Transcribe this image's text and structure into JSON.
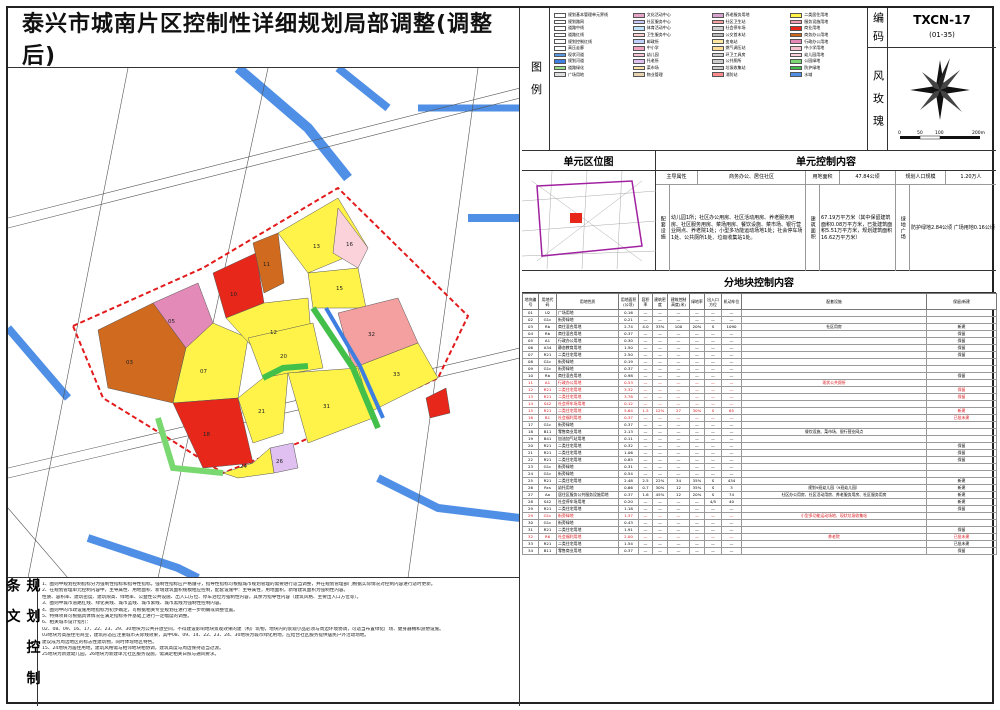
{
  "title": "泰兴市城南片区控制性详细规划局部调整(调整后)",
  "code": {
    "label": "编 码",
    "value": "TXCN-17",
    "sub": "(01-35)"
  },
  "rose_label": "风 玫 瑰",
  "rose_scale": {
    "ticks": [
      "0",
      "50",
      "100",
      "200m"
    ]
  },
  "legend_label": "图 例",
  "legend": [
    {
      "label": "规划基本管理单元界线",
      "color": "#ffffff"
    },
    {
      "label": "文化活动中心",
      "color": "#e6a4c6"
    },
    {
      "label": "养老服务用地",
      "color": "#d9a3cf"
    },
    {
      "label": "二类居住用地",
      "color": "#fff34a"
    },
    {
      "label": "规划路网",
      "color": "#ffffff"
    },
    {
      "label": "社区服务中心",
      "color": "#c9c9ff"
    },
    {
      "label": "社区卫生站",
      "color": "#f4a0a0"
    },
    {
      "label": "服务设施用地",
      "color": "#f19bb0"
    },
    {
      "label": "道路中线",
      "color": "#ffffff"
    },
    {
      "label": "体育活动中心",
      "color": "#bfe3ff"
    },
    {
      "label": "社会停车场",
      "color": "#cfcfcf"
    },
    {
      "label": "商业用地",
      "color": "#e8271b"
    },
    {
      "label": "道路红线",
      "color": "#ffffff"
    },
    {
      "label": "卫生服务中心",
      "color": "#ffd0d0"
    },
    {
      "label": "公交首末站",
      "color": "#bbbbbb"
    },
    {
      "label": "商务办公用地",
      "color": "#d06a1f"
    },
    {
      "label": "规划控制红线",
      "color": "#ffffff"
    },
    {
      "label": "邮政所",
      "color": "#c0d0ff"
    },
    {
      "label": "变电站",
      "color": "#ffe6a0"
    },
    {
      "label": "行政办公用地",
      "color": "#e38ab8"
    },
    {
      "label": "高压走廊",
      "color": "#ffffff"
    },
    {
      "label": "中小学",
      "color": "#f2a3c0"
    },
    {
      "label": "燃气调压站",
      "color": "#ffdd99"
    },
    {
      "label": "中小学用地",
      "color": "#f7c2d0"
    },
    {
      "label": "现状河道",
      "color": "#5a9ae0"
    },
    {
      "label": "幼儿园",
      "color": "#fac6d6"
    },
    {
      "label": "环卫工具房",
      "color": "#cfcfcf"
    },
    {
      "label": "幼儿园用地",
      "color": "#fbd2da"
    },
    {
      "label": "规划河道",
      "color": "#3d7ee0"
    },
    {
      "label": "托老所",
      "color": "#e0c0f0"
    },
    {
      "label": "公共厕所",
      "color": "#cccccc"
    },
    {
      "label": "公园绿地",
      "color": "#79d86f"
    },
    {
      "label": "道路绿化",
      "color": "#9be089"
    },
    {
      "label": "菜市场",
      "color": "#ffe2a8"
    },
    {
      "label": "垃圾收集站",
      "color": "#cccccc"
    },
    {
      "label": "防护绿地",
      "color": "#43c04a"
    },
    {
      "label": "广场用地",
      "color": "#dfdfdf"
    },
    {
      "label": "物业管理",
      "color": "#e8d3b0"
    },
    {
      "label": "消防站",
      "color": "#ff8c8c"
    },
    {
      "label": "水域",
      "color": "#4f8fe6"
    }
  ],
  "unit_location": {
    "title": "单元区位图"
  },
  "unit_control": {
    "title": "单元控制内容",
    "main_attr_label": "主导属性",
    "main_attr_value": "商务办公、居住社区",
    "area_label": "用地面积",
    "area_value": "47.84公顷",
    "pop_label": "规划人口规模",
    "pop_value": "1.20万人",
    "facility_label": "配套设施",
    "facility_text": "幼儿园1所；社区办公用房、社区活动用房、养老服务用房、社区服务用房、菜场用房、餐饮设施、菜市场、银行营业网点、养老院1处；小型多功能运动场地1处；社会停车场1处、公共厕所1处、垃圾收集站1处。",
    "build_label": "建筑面积",
    "build_text": "67.19万平方米（其中保留建筑面积0.08万平方米，已批建筑面积5.51万平方米，规划建筑面积16.62万平方米）",
    "green_label": "绿地广场",
    "green_text": "防护绿地2.84公顷 广场用地0.16公顷"
  },
  "parcel": {
    "title": "分地块控制内容",
    "headers": [
      "地块编号",
      "用地代码",
      "用地性质",
      "用地面积(公顷)",
      "容积率",
      "建筑密度",
      "建筑控制高度(米)",
      "绿地率",
      "出入口方位",
      "机动车位",
      "配套设施",
      "保留/新建"
    ],
    "rows": [
      [
        "01",
        "U2",
        "广场用地",
        "0.16",
        "—",
        "—",
        "—",
        "—",
        "—",
        "—",
        "",
        "",
        ""
      ],
      [
        "02",
        "G1c",
        "街旁绿地",
        "0.21",
        "—",
        "—",
        "—",
        "—",
        "—",
        "—",
        "",
        "",
        ""
      ],
      [
        "03",
        "Rb",
        "商住混合用地",
        "2.74",
        "4.0",
        "33%",
        "100",
        "20%",
        "S",
        "1090",
        "社区用房",
        "新建",
        ""
      ],
      [
        "04",
        "Rb",
        "商住混合用地",
        "0.37",
        "—",
        "—",
        "—",
        "—",
        "—",
        "—",
        "",
        "保留",
        ""
      ],
      [
        "05",
        "A1",
        "行政办公用地",
        "0.30",
        "—",
        "—",
        "—",
        "—",
        "—",
        "—",
        "",
        "保留",
        ""
      ],
      [
        "06",
        "A34",
        "静态教育用地",
        "1.50",
        "—",
        "—",
        "—",
        "—",
        "—",
        "—",
        "",
        "保留",
        ""
      ],
      [
        "07",
        "R21",
        "二类住宅用地",
        "2.50",
        "—",
        "—",
        "—",
        "—",
        "—",
        "—",
        "",
        "保留",
        ""
      ],
      [
        "08",
        "G1c",
        "街旁绿地",
        "0.19",
        "—",
        "—",
        "—",
        "—",
        "—",
        "—",
        "",
        "",
        ""
      ],
      [
        "09",
        "G1c",
        "街旁绿地",
        "0.37",
        "—",
        "—",
        "—",
        "—",
        "—",
        "—",
        "",
        "",
        ""
      ],
      [
        "10",
        "Rb",
        "商住混合用地",
        "0.98",
        "—",
        "—",
        "—",
        "—",
        "—",
        "—",
        "",
        "保留",
        ""
      ],
      [
        "11",
        "A1",
        "行政办公用地",
        "0.53",
        "—",
        "—",
        "—",
        "—",
        "—",
        "—",
        "现状公共厕所",
        "",
        "red"
      ],
      [
        "12",
        "R21",
        "二类住宅用地",
        "3.32",
        "—",
        "—",
        "—",
        "—",
        "—",
        "—",
        "",
        "保留",
        "red"
      ],
      [
        "13",
        "R21",
        "二类住宅用地",
        "3.78",
        "—",
        "—",
        "—",
        "—",
        "—",
        "—",
        "",
        "保留",
        "red"
      ],
      [
        "14",
        "S42",
        "社会停车场用地",
        "0.12",
        "—",
        "—",
        "—",
        "—",
        "—",
        "—",
        "",
        "",
        "red"
      ],
      [
        "15",
        "R21",
        "二类住宅用地",
        "5.64",
        "1.5",
        "12%",
        "27",
        "30%",
        "S",
        "65",
        "",
        "新建",
        "red"
      ],
      [
        "16",
        "B1",
        "社会福利用地",
        "0.37",
        "—",
        "—",
        "—",
        "—",
        "—",
        "—",
        "",
        "已批未建",
        "red"
      ],
      [
        "17",
        "G1c",
        "街旁绿地",
        "0.37",
        "—",
        "—",
        "—",
        "—",
        "—",
        "—",
        "",
        "",
        ""
      ],
      [
        "18",
        "B11",
        "零售商业用地",
        "2.13",
        "—",
        "—",
        "—",
        "—",
        "—",
        "—",
        "餐饮设施、菜市场、银行营业网点",
        "",
        ""
      ],
      [
        "19",
        "B41",
        "加油加气站用地",
        "0.11",
        "—",
        "—",
        "—",
        "—",
        "—",
        "—",
        "",
        "",
        ""
      ],
      [
        "20",
        "R21",
        "二类住宅用地",
        "0.32",
        "—",
        "—",
        "—",
        "—",
        "—",
        "—",
        "",
        "保留",
        ""
      ],
      [
        "21",
        "R21",
        "二类住宅用地",
        "1.06",
        "—",
        "—",
        "—",
        "—",
        "—",
        "—",
        "",
        "保留",
        ""
      ],
      [
        "22",
        "R21",
        "二类住宅用地",
        "0.85",
        "—",
        "—",
        "—",
        "—",
        "—",
        "—",
        "",
        "保留",
        ""
      ],
      [
        "23",
        "G1c",
        "街旁绿地",
        "0.31",
        "—",
        "—",
        "—",
        "—",
        "—",
        "—",
        "",
        "",
        ""
      ],
      [
        "24",
        "G1c",
        "街旁绿地",
        "0.54",
        "—",
        "—",
        "—",
        "—",
        "—",
        "—",
        "",
        "",
        ""
      ],
      [
        "25",
        "R21",
        "二类住宅用地",
        "2.48",
        "2.5",
        "22%",
        "34",
        "35%",
        "S",
        "434",
        "",
        "新建",
        ""
      ],
      [
        "26",
        "Rcs",
        "幼托用地",
        "0.66",
        "0.7",
        "30%",
        "12",
        "35%",
        "S",
        "3",
        "规划9班幼儿园（9班幼儿园）",
        "新建",
        ""
      ],
      [
        "27",
        "Aa",
        "居住区服务公共服务设施用地",
        "0.37",
        "1.6",
        "45%",
        "12",
        "20%",
        "S",
        "74",
        "社区办公用房、社区活动用房、养老服务用房、社区服务用房",
        "新建",
        ""
      ],
      [
        "28",
        "S42",
        "社会停车场用地",
        "0.20",
        "—",
        "—",
        "—",
        "—",
        "4/5",
        "40",
        "",
        "新建",
        ""
      ],
      [
        "29",
        "R21",
        "二类住宅用地",
        "1.18",
        "—",
        "—",
        "—",
        "—",
        "—",
        "—",
        "",
        "保留",
        ""
      ],
      [
        "29",
        "G1c",
        "街旁绿地",
        "1.37",
        "—",
        "—",
        "—",
        "—",
        "—",
        "—",
        "小型多功能运动场地、现状垃圾收集站",
        "",
        "red"
      ],
      [
        "30",
        "G1c",
        "街旁绿地",
        "0.43",
        "—",
        "—",
        "—",
        "—",
        "—",
        "—",
        "",
        "",
        ""
      ],
      [
        "31",
        "R21",
        "二类住宅用地",
        "1.91",
        "—",
        "—",
        "—",
        "—",
        "—",
        "—",
        "",
        "保留",
        ""
      ],
      [
        "32",
        "R6",
        "社会福利用地",
        "2.00",
        "—",
        "—",
        "—",
        "—",
        "—",
        "—",
        "养老院",
        "已批未建",
        "red"
      ],
      [
        "33",
        "R21",
        "二类住宅用地",
        "1.54",
        "—",
        "—",
        "—",
        "—",
        "—",
        "—",
        "",
        "已批未建",
        ""
      ],
      [
        "34",
        "B11",
        "零售商业用地",
        "0.37",
        "—",
        "—",
        "—",
        "—",
        "—",
        "—",
        "",
        "保留",
        ""
      ]
    ]
  },
  "notes": {
    "title": "规 划 控 制 条 文",
    "lines": [
      "1、图则中规划控制指标分为强制性指标和指导性指标。强制性指标应严格遵守，指导性指标可根据城市规划管理的需要进行适当调整，并在规划管理部门根据实际情况对控制内容进行适时更新。",
      "2、在规划管理单元控制内容中，主导属性、用地面积、新增建筑面积规模相应控制，配套设施中：主导属性，用地面积，新增建筑面积为强制性内容。",
      "性质、容积率、建筑密度、建筑限高、绿地率、公益性公共设施、出入口方位、停车泊位为强制性内容，其余为指导性内容（建筑风格、主要出入口方位等）。",
      "3、图则中城市道路红线、绿化黄线、城市蓝线、城市紫线、城市黑线为强制性控制内容。",
      "4、图则中的市政设施用地指标为初步确定，可根据相关专业规划在进行进一步明确或调整位置。",
      "5、特殊项目可根据具体情况在满足指标条件基础上进行一定幅度的调整。",
      "6、相关城市设计指引：",
      "02、08、09、16、17、22、23、29、30地块为公共开放空间，不得建设影响地块景观效果的建（构）筑物，地块内的景观小品必须与周边环境协调，可适当布置绿化广场、健身器械和游憩设施。",
      "03地块为高层住宅商业，建筑形态应注重城市天际线效果，其中08、09、14、22、23、24、30地块为城市绿化用地，应结合社区服务提供居民户外活动场地。",
      "建议成为周边地区的标志性建筑物，同时体现地区特色。",
      "15、24地块为居住用地，建筑风格需与相邻地块相协调，建筑高度与周边保持适当过渡。",
      "25地块为新建幼儿园，26地块为新建单元社区服务设施，需满足相关日照与通风要求。"
    ]
  }
}
